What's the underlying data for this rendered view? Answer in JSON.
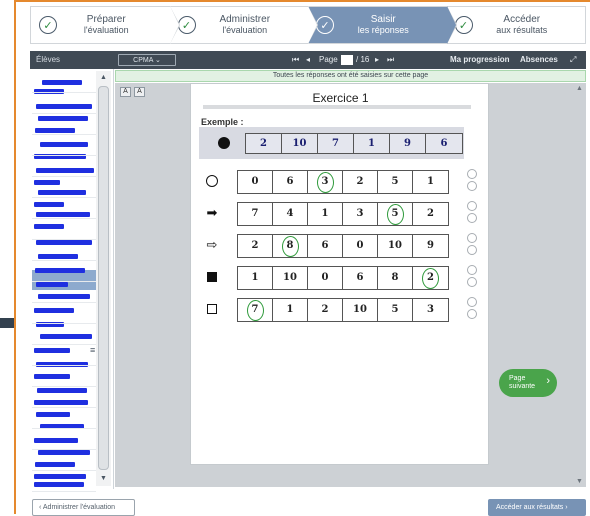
{
  "stepper": [
    {
      "line1": "Préparer",
      "line2": "l'évaluation",
      "active": false
    },
    {
      "line1": "Administrer",
      "line2": "l'évaluation",
      "active": false
    },
    {
      "line1": "Saisir",
      "line2": "les réponses",
      "active": true
    },
    {
      "line1": "Accéder",
      "line2": "aux résultats",
      "active": false
    }
  ],
  "toolbar": {
    "students_label": "Élèves",
    "class_select": "CPMA ⌄",
    "page_label": "Page",
    "page_total": "/ 16",
    "progress_label": "Ma progression",
    "absences_label": "Absences"
  },
  "banner": "Toutes les réponses ont été saisies sur cette page",
  "zoom": [
    "A",
    "A"
  ],
  "exercise": {
    "title": "Exercice 1",
    "example_label": "Exemple :",
    "example_values": [
      "2",
      "10",
      "7",
      "1",
      "9",
      "6"
    ],
    "rows": [
      {
        "symbol": "circle",
        "values": [
          "0",
          "6",
          "3",
          "2",
          "5",
          "1"
        ],
        "circled": 2
      },
      {
        "symbol": "arrow-filled",
        "values": [
          "7",
          "4",
          "1",
          "3",
          "5",
          "2"
        ],
        "circled": 4
      },
      {
        "symbol": "arrow-outline",
        "values": [
          "2",
          "8",
          "6",
          "0",
          "10",
          "9"
        ],
        "circled": 1
      },
      {
        "symbol": "square-filled",
        "values": [
          "1",
          "10",
          "0",
          "6",
          "8",
          "2"
        ],
        "circled": 5
      },
      {
        "symbol": "square-outline",
        "values": [
          "7",
          "1",
          "2",
          "10",
          "5",
          "3"
        ],
        "circled": 0
      }
    ]
  },
  "next_page": {
    "line1": "Page",
    "line2": "suivante"
  },
  "footer": {
    "back_label": "‹  Administrer l'évaluation",
    "forward_label": "Accéder aux résultats  ›"
  }
}
